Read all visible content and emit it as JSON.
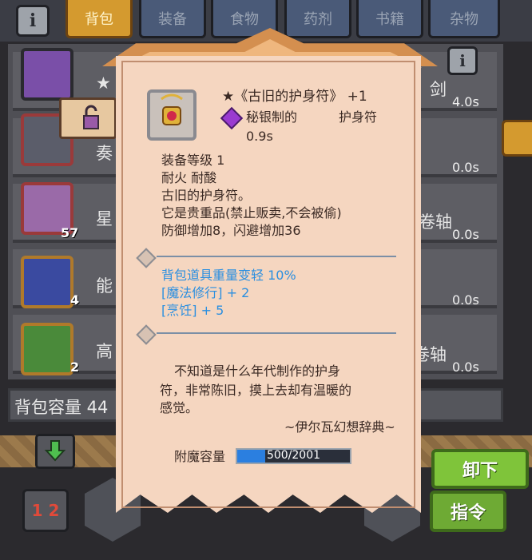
{
  "tabs": [
    {
      "label": "背包",
      "active": true
    },
    {
      "label": "装备",
      "active": false
    },
    {
      "label": "食物",
      "active": false
    },
    {
      "label": "药剂",
      "active": false
    },
    {
      "label": "书籍",
      "active": false
    },
    {
      "label": "杂物",
      "active": false
    }
  ],
  "info_symbol": "i",
  "list_rows": [
    {
      "name_fragment": "★",
      "name_right": "剑",
      "time": "4.0s",
      "count": "",
      "icon": "shell-icon"
    },
    {
      "name_fragment": "奏",
      "name_right": "",
      "time": "0.0s",
      "count": "",
      "icon": "axe-icon"
    },
    {
      "name_fragment": "星",
      "name_right": "卷轴",
      "time": "0.0s",
      "count": "57",
      "icon": "crystal-icon"
    },
    {
      "name_fragment": "能",
      "name_right": "",
      "time": "0.0s",
      "count": "4",
      "icon": "blue-scroll-icon"
    },
    {
      "name_fragment": "高",
      "name_right": "化卷轴",
      "time": "0.0s",
      "count": "2",
      "icon": "green-scroll-icon"
    }
  ],
  "capacity_label": "背包容量 44",
  "unload_label": "卸下",
  "command_label": "指令",
  "sort_label": "1 2",
  "popup": {
    "title": "★《古旧的护身符》 +1",
    "material": "秘银制的",
    "type": "护身符",
    "time": "0.9s",
    "stats": [
      "装备等级 1",
      "耐火  耐酸",
      "古旧的护身符。",
      "它是贵重品(禁止贩卖,不会被偷)",
      "防御增加8，闪避增加36"
    ],
    "bonuses": [
      "背包道具重量变轻 10%",
      "[魔法修行] + 2",
      "[烹饪] + 5"
    ],
    "description_lines": [
      "不知道是什么年代制作的护身",
      "符，非常陈旧，摸上去却有温暖的",
      "感觉。"
    ],
    "source": "~伊尔瓦幻想辞典~",
    "enchant_label": "附魔容量",
    "enchant_value": "500/2001",
    "enchant_fraction": 0.25
  },
  "colors": {
    "accent_tab": "#d49a2f",
    "bonus_text": "#2b8fe0",
    "button_green": "#7fc43a"
  }
}
